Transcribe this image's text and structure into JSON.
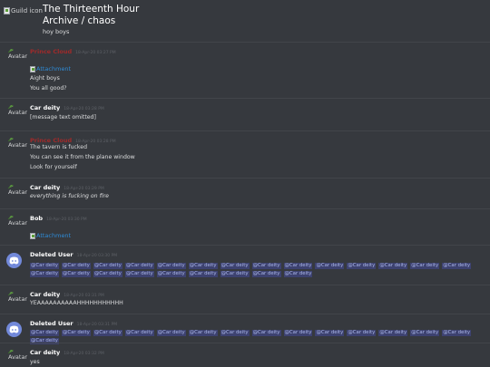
{
  "header": {
    "guild_icon_alt": "Guild icon",
    "guild_name": "The Thirteenth Hour",
    "channel_name": "Archive / chaos",
    "topic": "hoy boys"
  },
  "common": {
    "avatar_alt": "Avatar",
    "attachment_alt": "Attachment",
    "mention": "@Car deity"
  },
  "messages": [
    {
      "author": "Prince Cloud",
      "ts": "18-Apr-20 03:27 PM",
      "attachment": "Attachment",
      "lines": [
        "Aight boys",
        "You all good?"
      ]
    },
    {
      "author": "Car deity",
      "ts": "18-Apr-20 03:28 PM",
      "lines": [
        "[message text omitted]"
      ]
    },
    {
      "author": "Prince Cloud",
      "ts": "18-Apr-20 03:28 PM",
      "lines": [
        "The tavern is fucked",
        "You can see it from the plane window",
        "Look for yourself"
      ]
    },
    {
      "author": "Car deity",
      "ts": "18-Apr-20 03:29 PM",
      "lines": [
        "everything is fucking on fire"
      ]
    },
    {
      "author": "Bob",
      "ts": "18-Apr-20 03:30 PM",
      "attachment": "Attachment"
    },
    {
      "author": "Deleted User",
      "ts": "18-Apr-20 03:30 PM",
      "mention_count": 23
    },
    {
      "author": "Car deity",
      "ts": "18-Apr-20 03:31 PM",
      "lines": [
        "YEAAAAAAAAAAHHHHHHHHHHH"
      ]
    },
    {
      "author": "Deleted User",
      "ts": "18-Apr-20 03:31 PM",
      "mention_count": 15
    },
    {
      "author": "Car deity",
      "ts": "18-Apr-20 03:32 PM",
      "lines": [
        "yes"
      ]
    }
  ],
  "colors": {
    "background": "#36393e",
    "author_red": "#a02a2a",
    "mention_bg": "#3d4270",
    "discord_blurple": "#7289da",
    "link": "#2e8bd6"
  }
}
